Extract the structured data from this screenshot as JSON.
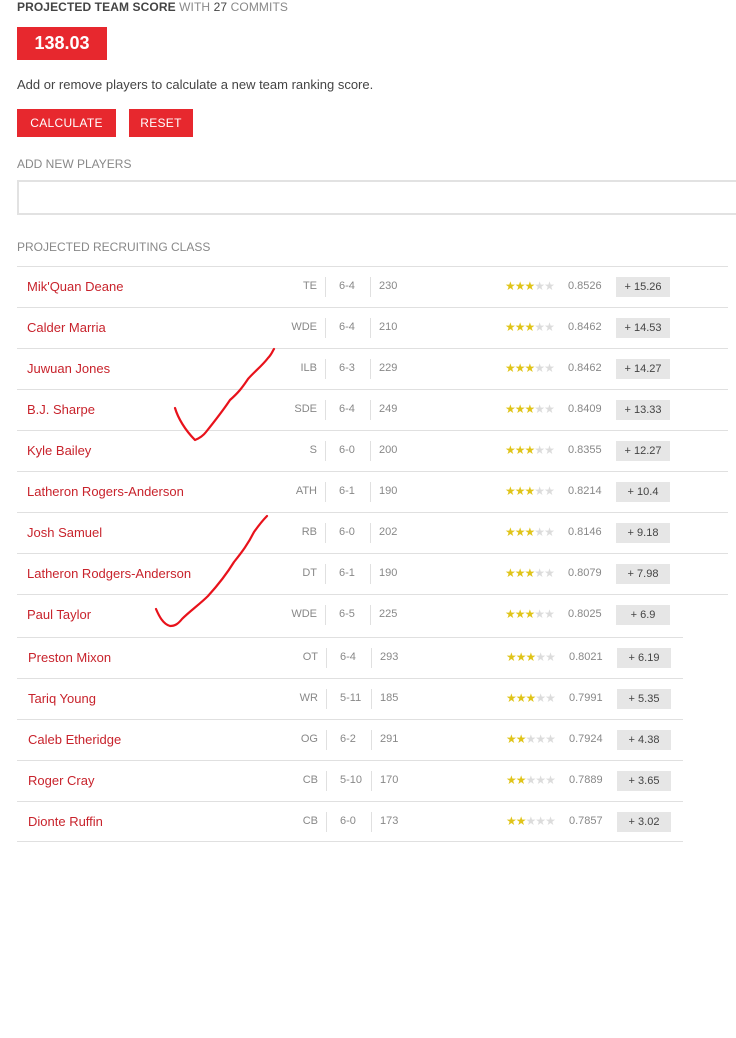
{
  "header": {
    "title_strong": "PROJECTED TEAM SCORE",
    "title_with": "WITH",
    "commit_count": "27",
    "title_commits": "COMMITS",
    "score": "138.03",
    "description": "Add or remove players to calculate a new team ranking score."
  },
  "buttons": {
    "calculate": "CALCULATE",
    "reset": "RESET"
  },
  "add_players": {
    "label": "ADD NEW PLAYERS",
    "value": "",
    "placeholder": ""
  },
  "recruiting_class": {
    "label": "PROJECTED RECRUITING CLASS",
    "players": [
      {
        "name": "Mik'Quan Deane",
        "pos": "TE",
        "height": "6-4",
        "weight": "230",
        "stars": 3,
        "rating": "0.8526",
        "points": "+ 15.26"
      },
      {
        "name": "Calder Marria",
        "pos": "WDE",
        "height": "6-4",
        "weight": "210",
        "stars": 3,
        "rating": "0.8462",
        "points": "+ 14.53"
      },
      {
        "name": "Juwuan Jones",
        "pos": "ILB",
        "height": "6-3",
        "weight": "229",
        "stars": 3,
        "rating": "0.8462",
        "points": "+ 14.27"
      },
      {
        "name": "B.J. Sharpe",
        "pos": "SDE",
        "height": "6-4",
        "weight": "249",
        "stars": 3,
        "rating": "0.8409",
        "points": "+ 13.33"
      },
      {
        "name": "Kyle Bailey",
        "pos": "S",
        "height": "6-0",
        "weight": "200",
        "stars": 3,
        "rating": "0.8355",
        "points": "+ 12.27"
      },
      {
        "name": "Latheron Rogers-Anderson",
        "pos": "ATH",
        "height": "6-1",
        "weight": "190",
        "stars": 3,
        "rating": "0.8214",
        "points": "+ 10.4"
      },
      {
        "name": "Josh Samuel",
        "pos": "RB",
        "height": "6-0",
        "weight": "202",
        "stars": 3,
        "rating": "0.8146",
        "points": "+ 9.18"
      },
      {
        "name": "Latheron Rodgers-Anderson",
        "pos": "DT",
        "height": "6-1",
        "weight": "190",
        "stars": 3,
        "rating": "0.8079",
        "points": "+ 7.98"
      },
      {
        "name": "Paul Taylor",
        "pos": "WDE",
        "height": "6-5",
        "weight": "225",
        "stars": 3,
        "rating": "0.8025",
        "points": "+ 6.9"
      },
      {
        "name": "Preston Mixon",
        "pos": "OT",
        "height": "6-4",
        "weight": "293",
        "stars": 3,
        "rating": "0.8021",
        "points": "+ 6.19"
      },
      {
        "name": "Tariq Young",
        "pos": "WR",
        "height": "5-11",
        "weight": "185",
        "stars": 3,
        "rating": "0.7991",
        "points": "+ 5.35"
      },
      {
        "name": "Caleb Etheridge",
        "pos": "OG",
        "height": "6-2",
        "weight": "291",
        "stars": 2,
        "rating": "0.7924",
        "points": "+ 4.38"
      },
      {
        "name": "Roger Cray",
        "pos": "CB",
        "height": "5-10",
        "weight": "170",
        "stars": 2,
        "rating": "0.7889",
        "points": "+ 3.65"
      },
      {
        "name": "Dionte Ruffin",
        "pos": "CB",
        "height": "6-0",
        "weight": "173",
        "stars": 2,
        "rating": "0.7857",
        "points": "+ 3.02"
      }
    ]
  },
  "colors": {
    "accent": "#e7282e",
    "link": "#c8232c",
    "star_on": "#e0c419",
    "star_off": "#dcdcdc",
    "annotation_ink": "#e8121b"
  }
}
